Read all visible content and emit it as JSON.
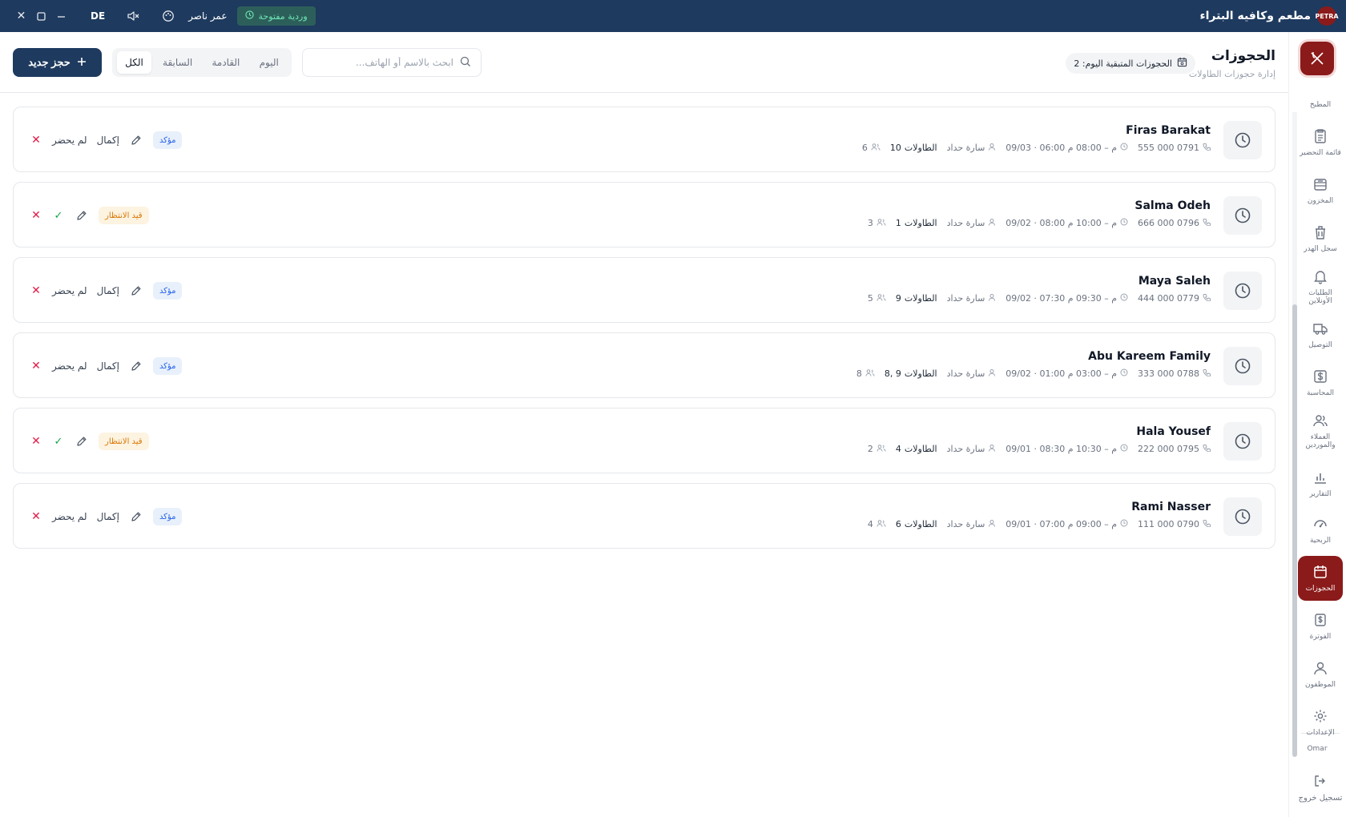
{
  "titlebar": {
    "app_name": "مطعم وكافيه البتراء",
    "logo_text": "PETRA",
    "user_name": "عمر ناصر",
    "lang": "DE",
    "shift_label": "وردية مفتوحة"
  },
  "sidebar": {
    "items": [
      {
        "label": "المطبخ",
        "icon": "chef-icon"
      },
      {
        "label": "قائمة التحضير",
        "icon": "clipboard-icon"
      },
      {
        "label": "المخزون",
        "icon": "inventory-icon"
      },
      {
        "label": "سجل الهدر",
        "icon": "trash-icon"
      },
      {
        "label": "الطلبات الأونلاين",
        "icon": "bell-icon"
      },
      {
        "label": "التوصيل",
        "icon": "truck-icon"
      },
      {
        "label": "المحاسبة",
        "icon": "dollar-icon"
      },
      {
        "label": "العملاء والموردين",
        "icon": "users-icon"
      },
      {
        "label": "التقارير",
        "icon": "bar-chart-icon"
      },
      {
        "label": "الربحية",
        "icon": "gauge-icon"
      },
      {
        "label": "الحجوزات",
        "icon": "calendar-icon",
        "active": true
      },
      {
        "label": "الفوترة",
        "icon": "invoice-icon"
      },
      {
        "label": "الموظفون",
        "icon": "user-icon"
      },
      {
        "label": "الإعدادات",
        "icon": "gear-icon"
      }
    ],
    "user_short": "Omar",
    "logout_label": "تسجيل خروج"
  },
  "header": {
    "title": "الحجوزات",
    "subtitle": "إدارة حجوزات الطاولات",
    "remaining_label": "الحجوزات المتبقية اليوم: 2",
    "search_placeholder": "ابحث بالاسم أو الهاتف...",
    "filters": [
      "اليوم",
      "القادمة",
      "السابقة",
      "الكل"
    ],
    "active_filter": "الكل",
    "new_button": "حجز جديد"
  },
  "labels": {
    "tables": "الطاولات",
    "complete": "إكمال",
    "no_show": "لم يحضر"
  },
  "reservations": [
    {
      "name": "Firas Barakat",
      "phone": "555 000 0791",
      "date_time": "09/03 · 06:00 م – 08:00 م",
      "host": "سارة حداد",
      "tables": "10",
      "guests": "6",
      "status": "مؤكد",
      "status_type": "confirmed"
    },
    {
      "name": "Salma Odeh",
      "phone": "666 000 0796",
      "date_time": "09/02 · 08:00 م – 10:00 م",
      "host": "سارة حداد",
      "tables": "1",
      "guests": "3",
      "status": "قيد الانتظار",
      "status_type": "pending"
    },
    {
      "name": "Maya Saleh",
      "phone": "444 000 0779",
      "date_time": "09/02 · 07:30 م – 09:30 م",
      "host": "سارة حداد",
      "tables": "9",
      "guests": "5",
      "status": "مؤكد",
      "status_type": "confirmed"
    },
    {
      "name": "Abu Kareem Family",
      "phone": "333 000 0788",
      "date_time": "09/02 · 01:00 م – 03:00 م",
      "host": "سارة حداد",
      "tables": "8, 9",
      "guests": "8",
      "status": "مؤكد",
      "status_type": "confirmed"
    },
    {
      "name": "Hala Yousef",
      "phone": "222 000 0795",
      "date_time": "09/01 · 08:30 م – 10:30 م",
      "host": "سارة حداد",
      "tables": "4",
      "guests": "2",
      "status": "قيد الانتظار",
      "status_type": "pending"
    },
    {
      "name": "Rami Nasser",
      "phone": "111 000 0790",
      "date_time": "09/01 · 07:00 م – 09:00 م",
      "host": "سارة حداد",
      "tables": "6",
      "guests": "4",
      "status": "مؤكد",
      "status_type": "confirmed"
    }
  ]
}
